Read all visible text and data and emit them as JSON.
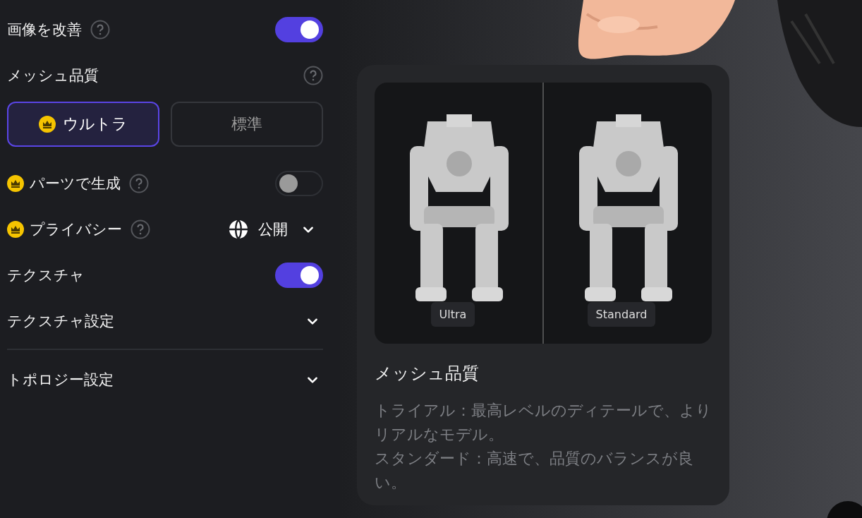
{
  "panel": {
    "items": [
      {
        "kind": "toggle",
        "label": "画像を改善",
        "premium": false,
        "help": true,
        "on": true
      },
      {
        "kind": "heading",
        "label": "メッシュ品質",
        "help": true
      },
      {
        "kind": "segmented",
        "options": [
          {
            "label": "ウルトラ",
            "premium": true,
            "selected": true
          },
          {
            "label": "標準",
            "premium": false,
            "selected": false
          }
        ]
      },
      {
        "kind": "toggle",
        "label": "パーツで生成",
        "premium": true,
        "help": true,
        "on": false
      },
      {
        "kind": "select",
        "label": "プライバシー",
        "premium": true,
        "help": true,
        "value": "公開"
      },
      {
        "kind": "toggle",
        "label": "テクスチャ",
        "premium": false,
        "help": false,
        "on": true
      },
      {
        "kind": "collapsible",
        "label": "テクスチャ設定",
        "expanded": false
      },
      {
        "kind": "divider"
      },
      {
        "kind": "collapsible",
        "label": "トポロジー設定",
        "expanded": false
      }
    ]
  },
  "info_card": {
    "labels": [
      "Ultra",
      "Standard"
    ],
    "title": "メッシュ品質",
    "description": [
      "トライアル：最高レベルのディテールで、よりリアルなモデル。",
      "スタンダード：高速で、品質のバランスが良い。"
    ]
  }
}
